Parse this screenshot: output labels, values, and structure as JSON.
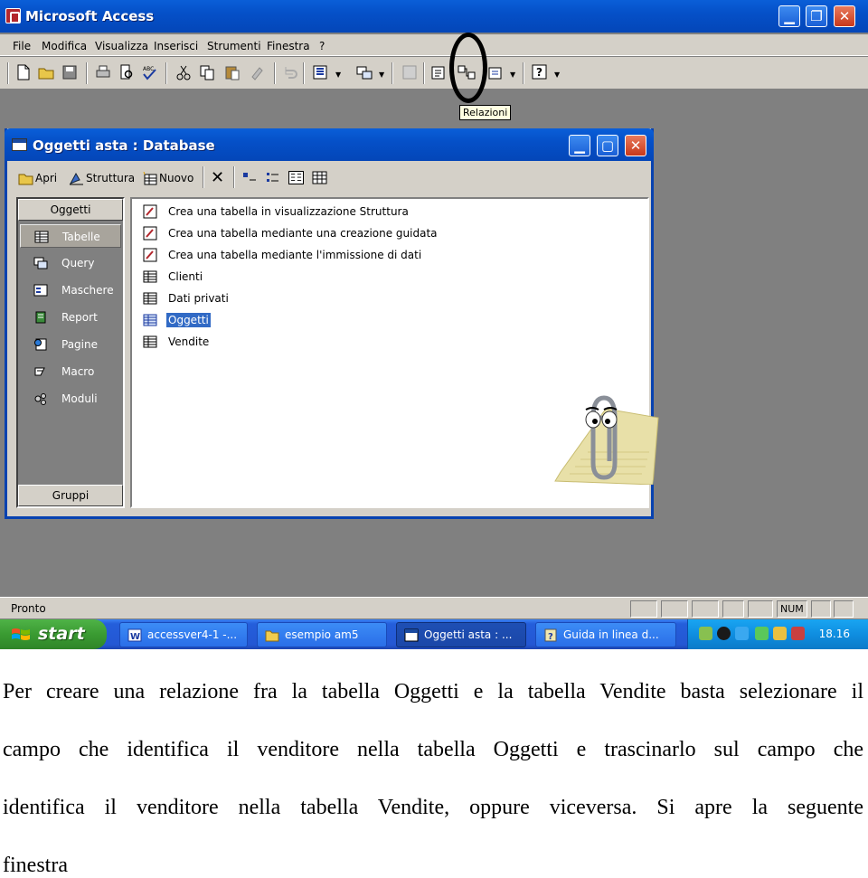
{
  "app": {
    "title": "Microsoft Access",
    "window_buttons": [
      "minimize",
      "restore",
      "close"
    ]
  },
  "menubar": {
    "items": [
      "File",
      "Modifica",
      "Visualizza",
      "Inserisci",
      "Strumenti",
      "Finestra",
      "?"
    ]
  },
  "toolbar": {
    "tooltip": "Relazioni",
    "icons": [
      "new-icon",
      "open-icon",
      "save-icon",
      "print-icon",
      "print-preview-icon",
      "spelling-icon",
      "cut-icon",
      "copy-icon",
      "paste-icon",
      "format-painter-icon",
      "undo-icon",
      "office-links-icon",
      "analyze-icon",
      "code-icon",
      "properties-icon",
      "relationships-icon",
      "new-object-icon",
      "help-icon"
    ]
  },
  "database_window": {
    "title": "Oggetti asta : Database",
    "toolbar": {
      "open_label": "Apri",
      "design_label": "Struttura",
      "new_label": "Nuovo"
    },
    "objects_header": "Oggetti",
    "groups_footer": "Gruppi",
    "objects": [
      {
        "label": "Tabelle",
        "icon": "table-icon",
        "selected": true
      },
      {
        "label": "Query",
        "icon": "query-icon",
        "selected": false
      },
      {
        "label": "Maschere",
        "icon": "form-icon",
        "selected": false
      },
      {
        "label": "Report",
        "icon": "report-icon",
        "selected": false
      },
      {
        "label": "Pagine",
        "icon": "page-icon",
        "selected": false
      },
      {
        "label": "Macro",
        "icon": "macro-icon",
        "selected": false
      },
      {
        "label": "Moduli",
        "icon": "module-icon",
        "selected": false
      }
    ],
    "list_items": [
      {
        "label": "Crea una tabella in visualizzazione Struttura",
        "icon": "wizard-icon",
        "selected": false
      },
      {
        "label": "Crea una tabella mediante una creazione guidata",
        "icon": "wizard-icon",
        "selected": false
      },
      {
        "label": "Crea una tabella mediante l'immissione di dati",
        "icon": "wizard-icon",
        "selected": false
      },
      {
        "label": "Clienti",
        "icon": "table-icon",
        "selected": false
      },
      {
        "label": "Dati privati",
        "icon": "table-icon",
        "selected": false
      },
      {
        "label": "Oggetti",
        "icon": "table-icon",
        "selected": true
      },
      {
        "label": "Vendite",
        "icon": "table-icon",
        "selected": false
      }
    ]
  },
  "statusbar": {
    "text": "Pronto",
    "num": "NUM"
  },
  "taskbar": {
    "start_label": "start",
    "buttons": [
      {
        "label": "accessver4-1 -...",
        "active": false
      },
      {
        "label": "esempio am5",
        "active": false
      },
      {
        "label": "Oggetti asta : ...",
        "active": true
      },
      {
        "label": "Guida in linea d...",
        "active": false
      }
    ],
    "clock": "18.16"
  },
  "document": {
    "lines": [
      "Per creare una relazione fra la tabella Oggetti e la tabella Vendite basta selezionare il",
      "campo che identifica il venditore nella tabella Oggetti e trascinarlo sul campo che",
      "identifica il venditore nella tabella Vendite, oppure viceversa. Si apre la seguente",
      "finestra"
    ]
  },
  "colors": {
    "title_blue": "#0550c8",
    "selection_blue": "#316ac5",
    "face_gray": "#d4d0c8",
    "workspace_gray": "#808080",
    "start_green": "#3a9b32"
  }
}
